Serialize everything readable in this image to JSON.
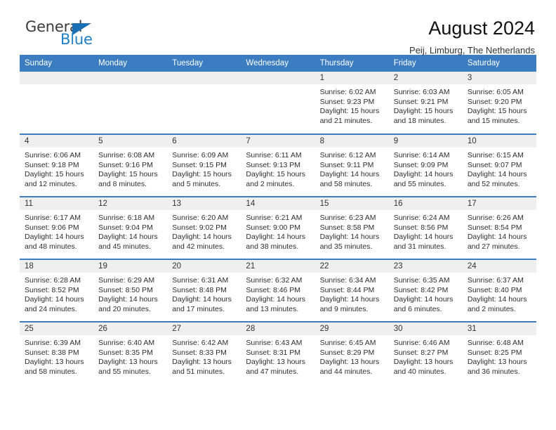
{
  "logo": {
    "word_one": "General",
    "word_two": "Blue",
    "triangle_color": "#1a6fb5",
    "blue_color": "#1f7fc4"
  },
  "header": {
    "title": "August 2024",
    "subtitle": "Peij, Limburg, The Netherlands"
  },
  "theme": {
    "header_blue": "#3b7dc0",
    "daynum_band": "#efefef",
    "text": "#2d2d2d"
  },
  "weekday_headers": [
    "Sunday",
    "Monday",
    "Tuesday",
    "Wednesday",
    "Thursday",
    "Friday",
    "Saturday"
  ],
  "weeks": [
    [
      {
        "day": "",
        "sunrise": "",
        "sunset": "",
        "daylight_line1": "",
        "daylight_line2": "",
        "empty": true
      },
      {
        "day": "",
        "sunrise": "",
        "sunset": "",
        "daylight_line1": "",
        "daylight_line2": "",
        "empty": true
      },
      {
        "day": "",
        "sunrise": "",
        "sunset": "",
        "daylight_line1": "",
        "daylight_line2": "",
        "empty": true
      },
      {
        "day": "",
        "sunrise": "",
        "sunset": "",
        "daylight_line1": "",
        "daylight_line2": "",
        "empty": true
      },
      {
        "day": "1",
        "sunrise": "Sunrise: 6:02 AM",
        "sunset": "Sunset: 9:23 PM",
        "daylight_line1": "Daylight: 15 hours",
        "daylight_line2": "and 21 minutes.",
        "empty": false
      },
      {
        "day": "2",
        "sunrise": "Sunrise: 6:03 AM",
        "sunset": "Sunset: 9:21 PM",
        "daylight_line1": "Daylight: 15 hours",
        "daylight_line2": "and 18 minutes.",
        "empty": false
      },
      {
        "day": "3",
        "sunrise": "Sunrise: 6:05 AM",
        "sunset": "Sunset: 9:20 PM",
        "daylight_line1": "Daylight: 15 hours",
        "daylight_line2": "and 15 minutes.",
        "empty": false
      }
    ],
    [
      {
        "day": "4",
        "sunrise": "Sunrise: 6:06 AM",
        "sunset": "Sunset: 9:18 PM",
        "daylight_line1": "Daylight: 15 hours",
        "daylight_line2": "and 12 minutes.",
        "empty": false
      },
      {
        "day": "5",
        "sunrise": "Sunrise: 6:08 AM",
        "sunset": "Sunset: 9:16 PM",
        "daylight_line1": "Daylight: 15 hours",
        "daylight_line2": "and 8 minutes.",
        "empty": false
      },
      {
        "day": "6",
        "sunrise": "Sunrise: 6:09 AM",
        "sunset": "Sunset: 9:15 PM",
        "daylight_line1": "Daylight: 15 hours",
        "daylight_line2": "and 5 minutes.",
        "empty": false
      },
      {
        "day": "7",
        "sunrise": "Sunrise: 6:11 AM",
        "sunset": "Sunset: 9:13 PM",
        "daylight_line1": "Daylight: 15 hours",
        "daylight_line2": "and 2 minutes.",
        "empty": false
      },
      {
        "day": "8",
        "sunrise": "Sunrise: 6:12 AM",
        "sunset": "Sunset: 9:11 PM",
        "daylight_line1": "Daylight: 14 hours",
        "daylight_line2": "and 58 minutes.",
        "empty": false
      },
      {
        "day": "9",
        "sunrise": "Sunrise: 6:14 AM",
        "sunset": "Sunset: 9:09 PM",
        "daylight_line1": "Daylight: 14 hours",
        "daylight_line2": "and 55 minutes.",
        "empty": false
      },
      {
        "day": "10",
        "sunrise": "Sunrise: 6:15 AM",
        "sunset": "Sunset: 9:07 PM",
        "daylight_line1": "Daylight: 14 hours",
        "daylight_line2": "and 52 minutes.",
        "empty": false
      }
    ],
    [
      {
        "day": "11",
        "sunrise": "Sunrise: 6:17 AM",
        "sunset": "Sunset: 9:06 PM",
        "daylight_line1": "Daylight: 14 hours",
        "daylight_line2": "and 48 minutes.",
        "empty": false
      },
      {
        "day": "12",
        "sunrise": "Sunrise: 6:18 AM",
        "sunset": "Sunset: 9:04 PM",
        "daylight_line1": "Daylight: 14 hours",
        "daylight_line2": "and 45 minutes.",
        "empty": false
      },
      {
        "day": "13",
        "sunrise": "Sunrise: 6:20 AM",
        "sunset": "Sunset: 9:02 PM",
        "daylight_line1": "Daylight: 14 hours",
        "daylight_line2": "and 42 minutes.",
        "empty": false
      },
      {
        "day": "14",
        "sunrise": "Sunrise: 6:21 AM",
        "sunset": "Sunset: 9:00 PM",
        "daylight_line1": "Daylight: 14 hours",
        "daylight_line2": "and 38 minutes.",
        "empty": false
      },
      {
        "day": "15",
        "sunrise": "Sunrise: 6:23 AM",
        "sunset": "Sunset: 8:58 PM",
        "daylight_line1": "Daylight: 14 hours",
        "daylight_line2": "and 35 minutes.",
        "empty": false
      },
      {
        "day": "16",
        "sunrise": "Sunrise: 6:24 AM",
        "sunset": "Sunset: 8:56 PM",
        "daylight_line1": "Daylight: 14 hours",
        "daylight_line2": "and 31 minutes.",
        "empty": false
      },
      {
        "day": "17",
        "sunrise": "Sunrise: 6:26 AM",
        "sunset": "Sunset: 8:54 PM",
        "daylight_line1": "Daylight: 14 hours",
        "daylight_line2": "and 27 minutes.",
        "empty": false
      }
    ],
    [
      {
        "day": "18",
        "sunrise": "Sunrise: 6:28 AM",
        "sunset": "Sunset: 8:52 PM",
        "daylight_line1": "Daylight: 14 hours",
        "daylight_line2": "and 24 minutes.",
        "empty": false
      },
      {
        "day": "19",
        "sunrise": "Sunrise: 6:29 AM",
        "sunset": "Sunset: 8:50 PM",
        "daylight_line1": "Daylight: 14 hours",
        "daylight_line2": "and 20 minutes.",
        "empty": false
      },
      {
        "day": "20",
        "sunrise": "Sunrise: 6:31 AM",
        "sunset": "Sunset: 8:48 PM",
        "daylight_line1": "Daylight: 14 hours",
        "daylight_line2": "and 17 minutes.",
        "empty": false
      },
      {
        "day": "21",
        "sunrise": "Sunrise: 6:32 AM",
        "sunset": "Sunset: 8:46 PM",
        "daylight_line1": "Daylight: 14 hours",
        "daylight_line2": "and 13 minutes.",
        "empty": false
      },
      {
        "day": "22",
        "sunrise": "Sunrise: 6:34 AM",
        "sunset": "Sunset: 8:44 PM",
        "daylight_line1": "Daylight: 14 hours",
        "daylight_line2": "and 9 minutes.",
        "empty": false
      },
      {
        "day": "23",
        "sunrise": "Sunrise: 6:35 AM",
        "sunset": "Sunset: 8:42 PM",
        "daylight_line1": "Daylight: 14 hours",
        "daylight_line2": "and 6 minutes.",
        "empty": false
      },
      {
        "day": "24",
        "sunrise": "Sunrise: 6:37 AM",
        "sunset": "Sunset: 8:40 PM",
        "daylight_line1": "Daylight: 14 hours",
        "daylight_line2": "and 2 minutes.",
        "empty": false
      }
    ],
    [
      {
        "day": "25",
        "sunrise": "Sunrise: 6:39 AM",
        "sunset": "Sunset: 8:38 PM",
        "daylight_line1": "Daylight: 13 hours",
        "daylight_line2": "and 58 minutes.",
        "empty": false
      },
      {
        "day": "26",
        "sunrise": "Sunrise: 6:40 AM",
        "sunset": "Sunset: 8:35 PM",
        "daylight_line1": "Daylight: 13 hours",
        "daylight_line2": "and 55 minutes.",
        "empty": false
      },
      {
        "day": "27",
        "sunrise": "Sunrise: 6:42 AM",
        "sunset": "Sunset: 8:33 PM",
        "daylight_line1": "Daylight: 13 hours",
        "daylight_line2": "and 51 minutes.",
        "empty": false
      },
      {
        "day": "28",
        "sunrise": "Sunrise: 6:43 AM",
        "sunset": "Sunset: 8:31 PM",
        "daylight_line1": "Daylight: 13 hours",
        "daylight_line2": "and 47 minutes.",
        "empty": false
      },
      {
        "day": "29",
        "sunrise": "Sunrise: 6:45 AM",
        "sunset": "Sunset: 8:29 PM",
        "daylight_line1": "Daylight: 13 hours",
        "daylight_line2": "and 44 minutes.",
        "empty": false
      },
      {
        "day": "30",
        "sunrise": "Sunrise: 6:46 AM",
        "sunset": "Sunset: 8:27 PM",
        "daylight_line1": "Daylight: 13 hours",
        "daylight_line2": "and 40 minutes.",
        "empty": false
      },
      {
        "day": "31",
        "sunrise": "Sunrise: 6:48 AM",
        "sunset": "Sunset: 8:25 PM",
        "daylight_line1": "Daylight: 13 hours",
        "daylight_line2": "and 36 minutes.",
        "empty": false
      }
    ]
  ]
}
